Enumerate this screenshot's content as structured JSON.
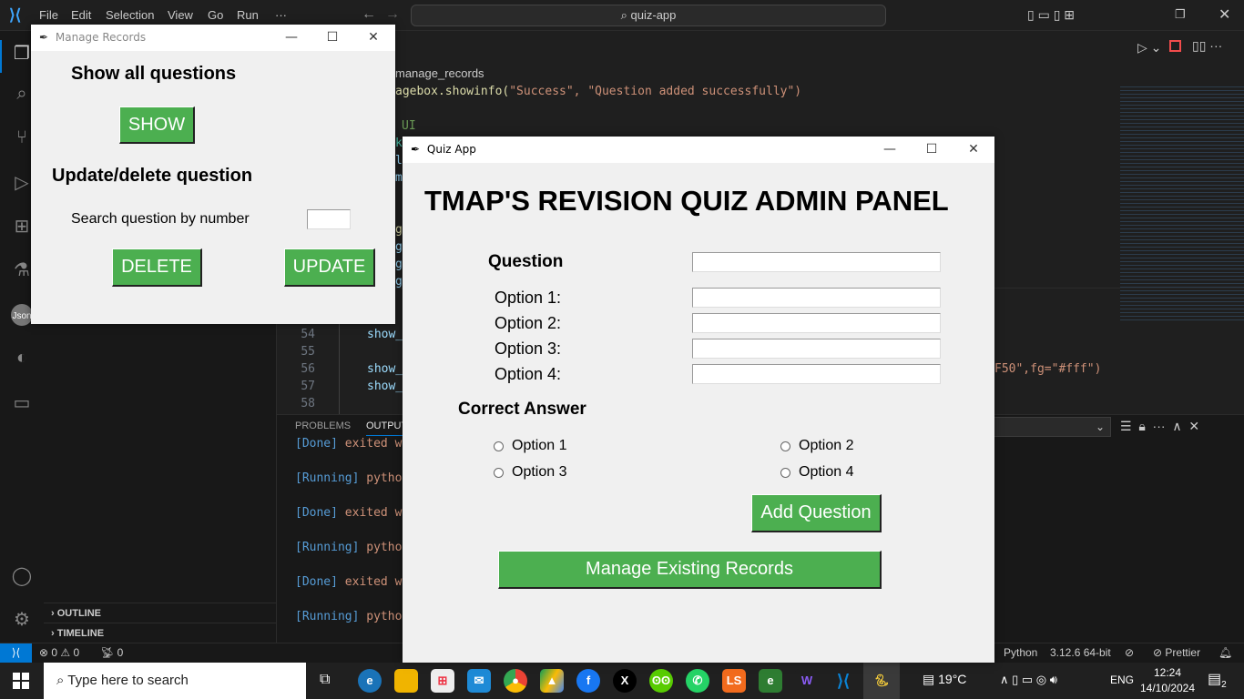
{
  "vscode": {
    "menu": [
      "File",
      "Edit",
      "Selection",
      "View",
      "Go",
      "Run",
      "···"
    ],
    "command_center": "quiz-app",
    "breadcrumb": "manage_records",
    "code_top": [
      {
        "text": "agebox.showinfo(",
        "cls": "fn"
      },
      {
        "text": "\"Success\", \"Question added successfully\")",
        "cls": "str"
      }
    ],
    "code_ui_comment": "UI",
    "code_fragments": [
      "k",
      "l",
      "m",
      "g",
      "g",
      "g",
      "g"
    ],
    "lines": [
      {
        "num": "54",
        "text": "show_"
      },
      {
        "num": "55",
        "text": ""
      },
      {
        "num": "56",
        "text": "show_",
        "tail": "F50\",fg=\"#fff\")"
      },
      {
        "num": "57",
        "text": "show_"
      },
      {
        "num": "58",
        "text": ""
      }
    ],
    "panel_tabs": [
      "PROBLEMS",
      "OUTPUT"
    ],
    "output": [
      {
        "tag": "[Done]",
        "rest": "exited w"
      },
      {
        "tag": "[Running]",
        "rest": "pytho"
      },
      {
        "tag": "[Done]",
        "rest": "exited w"
      },
      {
        "tag": "[Running]",
        "rest": "pytho"
      },
      {
        "tag": "[Done]",
        "rest": "exited w"
      },
      {
        "tag": "[Running]",
        "rest": "pytho"
      }
    ],
    "sidebar_sections": [
      "OUTLINE",
      "TIMELINE"
    ],
    "status": {
      "errors": "0",
      "warnings": "0",
      "ports": "0",
      "language": "Python",
      "interpreter": "3.12.6 64-bit",
      "prettier": "Prettier"
    }
  },
  "manage_window": {
    "title": "Manage Records",
    "show_heading": "Show all questions",
    "show_button": "SHOW",
    "update_heading": "Update/delete question",
    "search_label": "Search question by number",
    "search_value": "",
    "delete_button": "DELETE",
    "update_button": "UPDATE"
  },
  "quiz_window": {
    "title": "Quiz App",
    "heading": "TMAP'S REVISION QUIZ ADMIN PANEL",
    "question_label": "Question",
    "question_value": "",
    "options": [
      {
        "label": "Option 1:",
        "value": ""
      },
      {
        "label": "Option 2:",
        "value": ""
      },
      {
        "label": "Option 3:",
        "value": ""
      },
      {
        "label": "Option 4:",
        "value": ""
      }
    ],
    "correct_label": "Correct Answer",
    "radios": [
      "Option 1",
      "Option 2",
      "Option 3",
      "Option 4"
    ],
    "add_button": "Add Question",
    "manage_button": "Manage Existing Records",
    "accent": "#4caf50"
  },
  "taskbar": {
    "search_placeholder": "Type here to search",
    "weather": "19°C",
    "lang": "ENG",
    "time": "12:24",
    "date": "14/10/2024",
    "notifications": "2"
  }
}
